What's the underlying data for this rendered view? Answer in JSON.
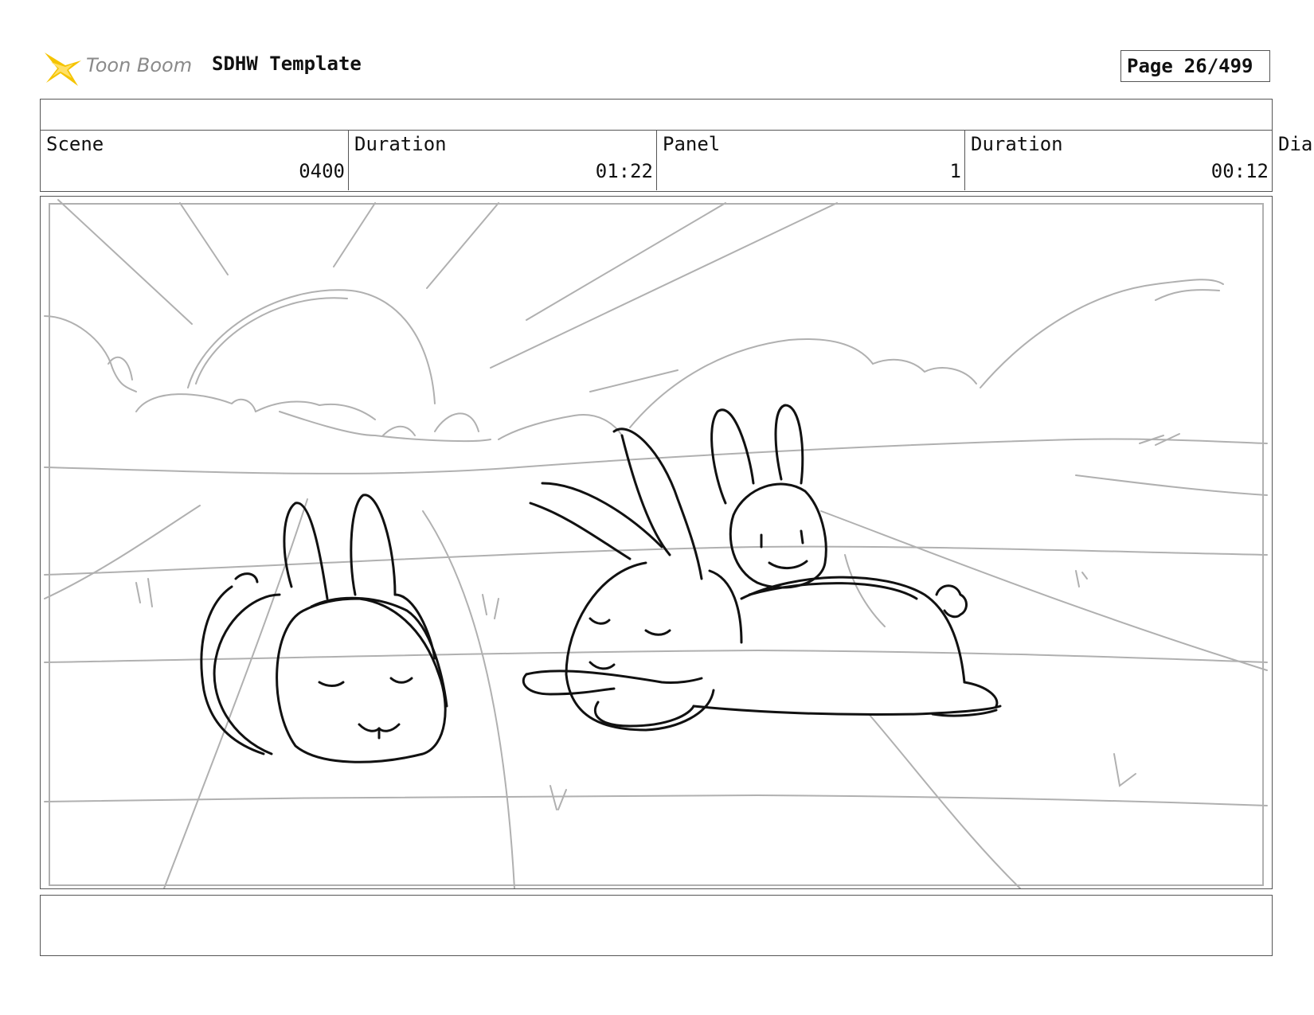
{
  "header": {
    "logo_text": "Toon Boom",
    "template_title": "SDHW Template",
    "page_label": "Page",
    "page_number": "26/499"
  },
  "info": {
    "scene_label": "Scene",
    "scene_value": "0400",
    "scene_duration_label": "Duration",
    "scene_duration_value": "01:22",
    "panel_label": "Panel",
    "panel_value": "1",
    "panel_duration_label": "Duration",
    "panel_duration_value": "00:12",
    "dialog_label_partial": "Dia"
  },
  "colors": {
    "border": "#555555",
    "sketch_gray": "#b0b0b0",
    "sketch_black": "#111111",
    "logo_yellow": "#f5c400"
  }
}
